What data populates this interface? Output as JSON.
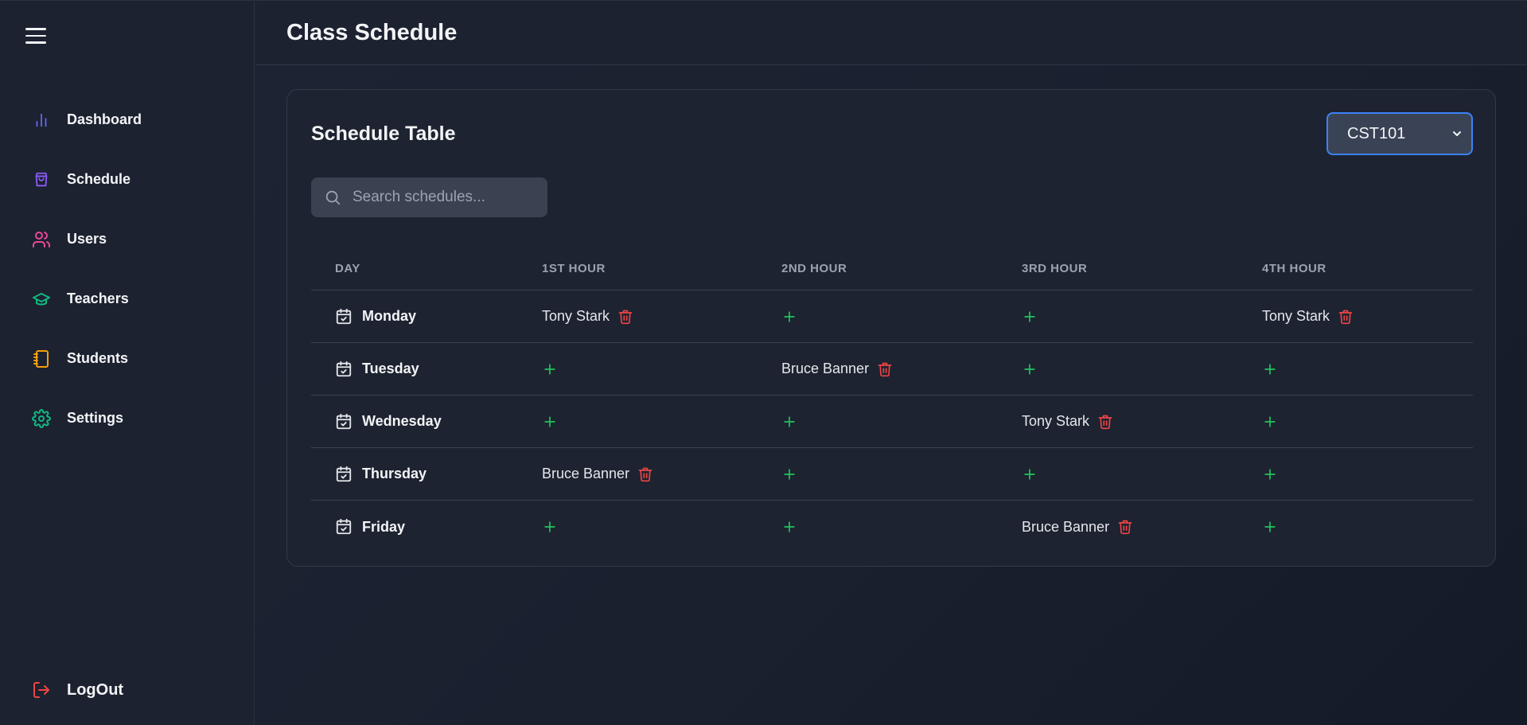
{
  "sidebar": {
    "items": [
      {
        "label": "Dashboard",
        "icon": "bar-chart-icon",
        "color": "#6366f1"
      },
      {
        "label": "Schedule",
        "icon": "shopping-bag-icon",
        "color": "#8b5cf6"
      },
      {
        "label": "Users",
        "icon": "users-icon",
        "color": "#ec4899"
      },
      {
        "label": "Teachers",
        "icon": "graduation-cap-icon",
        "color": "#10b981"
      },
      {
        "label": "Students",
        "icon": "notebook-icon",
        "color": "#f59e0b"
      },
      {
        "label": "Settings",
        "icon": "gear-icon",
        "color": "#10b981"
      }
    ],
    "logout_label": "LogOut",
    "logout_color": "#ef4444"
  },
  "header": {
    "title": "Class Schedule"
  },
  "card": {
    "title": "Schedule Table",
    "class_select": {
      "selected": "CST101"
    },
    "search": {
      "placeholder": "Search schedules..."
    }
  },
  "table": {
    "headers": [
      "DAY",
      "1ST HOUR",
      "2ND HOUR",
      "3RD HOUR",
      "4TH HOUR"
    ],
    "rows": [
      {
        "day": "Monday",
        "slots": [
          "Tony Stark",
          "",
          "",
          "Tony Stark"
        ]
      },
      {
        "day": "Tuesday",
        "slots": [
          "",
          "Bruce Banner",
          "",
          ""
        ]
      },
      {
        "day": "Wednesday",
        "slots": [
          "",
          "",
          "Tony Stark",
          ""
        ]
      },
      {
        "day": "Thursday",
        "slots": [
          "Bruce Banner",
          "",
          "",
          ""
        ]
      },
      {
        "day": "Friday",
        "slots": [
          "",
          "",
          "Bruce Banner",
          ""
        ]
      }
    ]
  },
  "colors": {
    "accent": "#3b82f6",
    "add": "#22c55e",
    "delete": "#ef4444"
  }
}
